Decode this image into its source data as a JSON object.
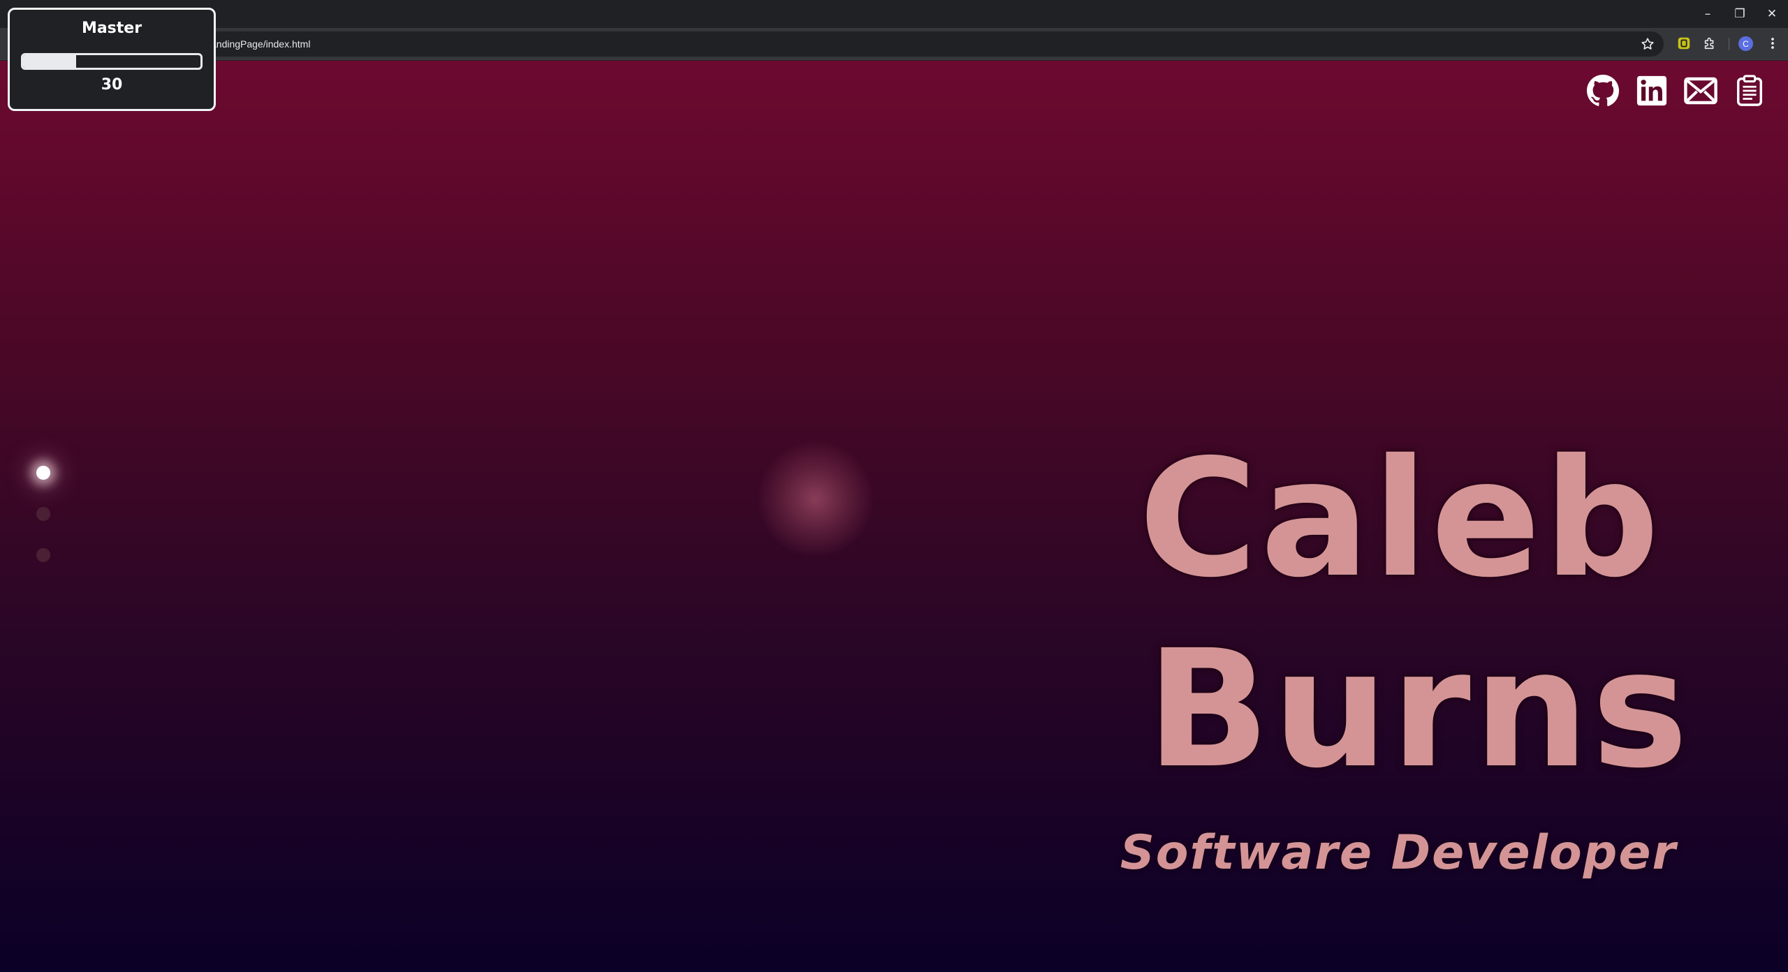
{
  "browser": {
    "url": "andingPage/index.html",
    "window_controls": [
      "–",
      "❐",
      "✕"
    ],
    "profile_initial": "C"
  },
  "volume_widget": {
    "label": "Master",
    "value": "30",
    "level_fraction": 0.3
  },
  "social_links": [
    {
      "icon": "github-icon",
      "label": "GitHub"
    },
    {
      "icon": "linkedin-icon",
      "label": "LinkedIn"
    },
    {
      "icon": "mail-icon",
      "label": "Email"
    },
    {
      "icon": "clipboard-icon",
      "label": "Resume"
    }
  ],
  "hero": {
    "first_name": "Caleb",
    "last_name": "Burns",
    "tagline": "Software Developer"
  },
  "section_nav": {
    "count": 3,
    "active_index": 0
  },
  "colors": {
    "accent_text": "#d49496",
    "gradient_top": "#6d0930",
    "gradient_bottom": "#0b0027"
  }
}
